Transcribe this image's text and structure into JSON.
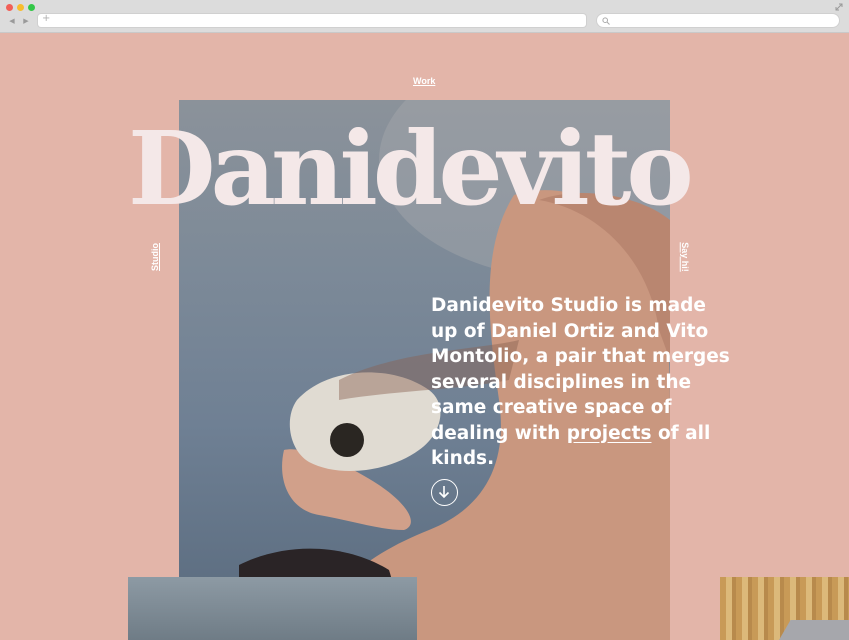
{
  "nav": {
    "work_label": "Work"
  },
  "hero": {
    "title": "Danidevito"
  },
  "side_links": {
    "studio_label": "Studio",
    "sayhi_label": "Say hi!"
  },
  "intro": {
    "text_before": "Danidevito Studio is made up of Daniel Ortiz and Vito Montolio, a pair that merges several disciplines in the same creative space of dealing with ",
    "link_text": "projects",
    "text_after": " of all kinds."
  },
  "icons": {
    "scroll": "arrow-down-circle-icon",
    "search": "search-icon",
    "new_tab": "plus-icon"
  },
  "colors": {
    "background": "#e3b5a9",
    "title": "#f4e8e8",
    "text": "#ffffff"
  }
}
